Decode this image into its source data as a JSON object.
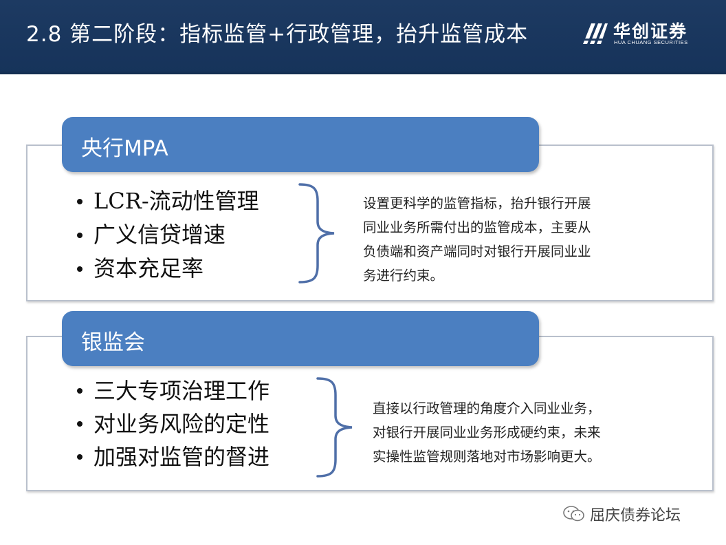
{
  "header": {
    "title": "2.8 第二阶段：指标监管+行政管理，抬升监管成本",
    "logo_cn": "华创证券",
    "logo_en": "HUA CHUANG SECURITIES",
    "background_color": "#1b3860"
  },
  "sections": [
    {
      "heading": "央行MPA",
      "bullets": [
        "LCR-流动性管理",
        "广义信贷增速",
        "资本充足率"
      ],
      "description": [
        "设置更科学的监管指标，抬升银行开展",
        "同业业务所需付出的监管成本，主要从",
        "负债端和资产端同时对银行开展同业业",
        "务进行约束。"
      ]
    },
    {
      "heading": "银监会",
      "bullets": [
        "三大专项治理工作",
        "对业务风险的定性",
        "加强对监管的督进"
      ],
      "description": [
        "直接以行政管理的角度介入同业业务，",
        "对银行开展同业业务形成硬约束，未来",
        "实操性监管规则落地对市场影响更大。"
      ]
    }
  ],
  "watermark": {
    "text": "屈庆债券论坛",
    "icon": "wechat-icon"
  },
  "colors": {
    "tab_fill": "#4b7fc1",
    "brace": "#4f6fa8",
    "panel_border": "#b9c0cc"
  }
}
